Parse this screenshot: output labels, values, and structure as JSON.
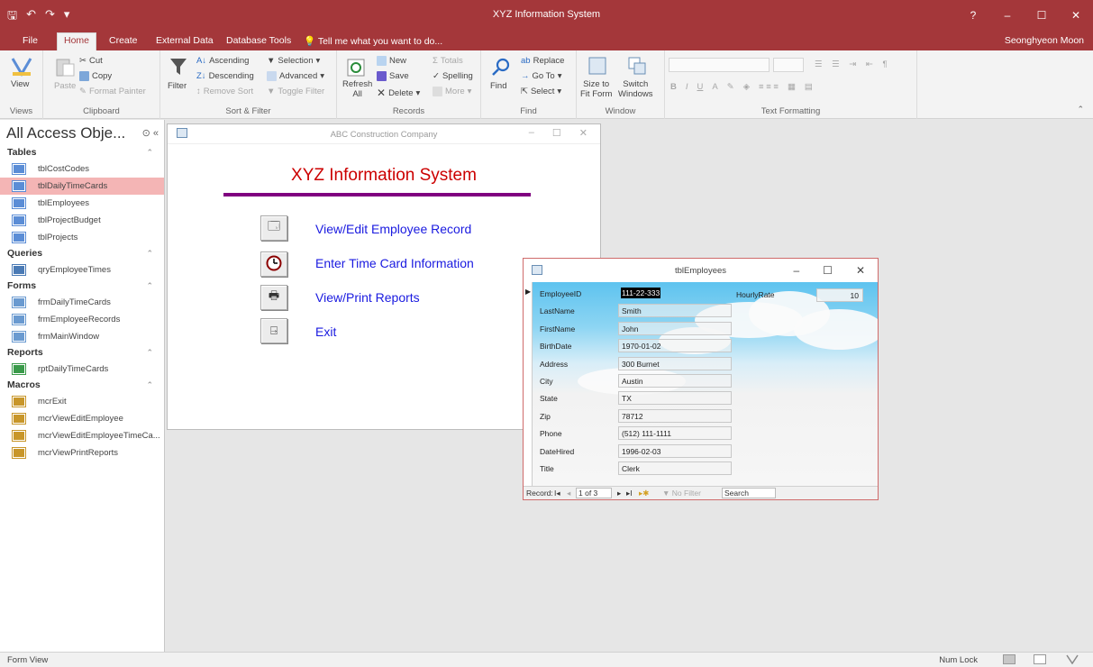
{
  "window": {
    "title": "XYZ Information System",
    "controls": [
      "?",
      "–",
      "☐",
      "✕"
    ]
  },
  "tabs": [
    "File",
    "Home",
    "Create",
    "External Data",
    "Database Tools"
  ],
  "tell_me": "Tell me what you want to do...",
  "user": "Seonghyeon Moon",
  "ribbon": {
    "views": {
      "view": "View",
      "label": "Views"
    },
    "clipboard": {
      "cut": "Cut",
      "copy": "Copy",
      "paste": "Paste",
      "format_painter": "Format Painter",
      "label": "Clipboard"
    },
    "sort_filter": {
      "filter": "Filter",
      "ascending": "Ascending",
      "descending": "Descending",
      "remove_sort": "Remove Sort",
      "selection": "Selection",
      "advanced": "Advanced",
      "toggle_filter": "Toggle Filter",
      "label": "Sort & Filter"
    },
    "records": {
      "refresh": "Refresh",
      "refresh_all": "All",
      "new": "New",
      "save": "Save",
      "delete": "Delete",
      "totals": "Totals",
      "spelling": "Spelling",
      "more": "More",
      "label": "Records"
    },
    "find": {
      "find": "Find",
      "replace": "Replace",
      "goto": "Go To",
      "select": "Select",
      "label": "Find"
    },
    "window": {
      "size_to": "Size to",
      "fit_form": "Fit Form",
      "switch": "Switch",
      "windows": "Windows",
      "label": "Window"
    },
    "text_formatting": {
      "label": "Text Formatting",
      "bold": "B",
      "italic": "I",
      "underline": "U",
      "font_color": "A"
    }
  },
  "nav": {
    "title": "All Access Obje...",
    "sections": [
      {
        "name": "Tables",
        "items": [
          "tblCostCodes",
          "tblDailyTimeCards",
          "tblEmployees",
          "tblProjectBudget",
          "tblProjects"
        ]
      },
      {
        "name": "Queries",
        "items": [
          "qryEmployeeTimes"
        ]
      },
      {
        "name": "Forms",
        "items": [
          "frmDailyTimeCards",
          "frmEmployeeRecords",
          "frmMainWindow"
        ]
      },
      {
        "name": "Reports",
        "items": [
          "rptDailyTimeCards"
        ]
      },
      {
        "name": "Macros",
        "items": [
          "mcrExit",
          "mcrViewEditEmployee",
          "mcrViewEditEmployeeTimeCa...",
          "mcrViewPrintReports"
        ]
      }
    ]
  },
  "main_form": {
    "window_title": "ABC Construction Company",
    "heading": "XYZ Information System",
    "buttons": [
      "View/Edit Employee Record",
      "Enter Time Card Information",
      "View/Print Reports",
      "Exit"
    ]
  },
  "employee_form": {
    "window_title": "tblEmployees",
    "fields": [
      {
        "label": "EmployeeID",
        "value": "111-22-333"
      },
      {
        "label": "LastName",
        "value": "Smith"
      },
      {
        "label": "FirstName",
        "value": "John"
      },
      {
        "label": "BirthDate",
        "value": "1970-01-02"
      },
      {
        "label": "Address",
        "value": "300 Burnet"
      },
      {
        "label": "City",
        "value": "Austin"
      },
      {
        "label": "State",
        "value": "TX"
      },
      {
        "label": "Zip",
        "value": "78712"
      },
      {
        "label": "Phone",
        "value": "(512) 111-1111"
      },
      {
        "label": "DateHired",
        "value": "1996-02-03"
      },
      {
        "label": "Title",
        "value": "Clerk"
      }
    ],
    "hourly_rate_label": "HourlyRate",
    "hourly_rate_value": "10",
    "nav": {
      "record_label": "Record:",
      "position": "1 of 3",
      "no_filter": "No Filter",
      "search": "Search"
    }
  },
  "status": {
    "left": "Form View",
    "num_lock": "Num Lock"
  },
  "colors": {
    "accent": "#a4373a",
    "selected_nav": "#f4b5b5",
    "heading_red": "#cc0000",
    "link_blue": "#1a1ae0",
    "divider_purple": "#800080"
  }
}
